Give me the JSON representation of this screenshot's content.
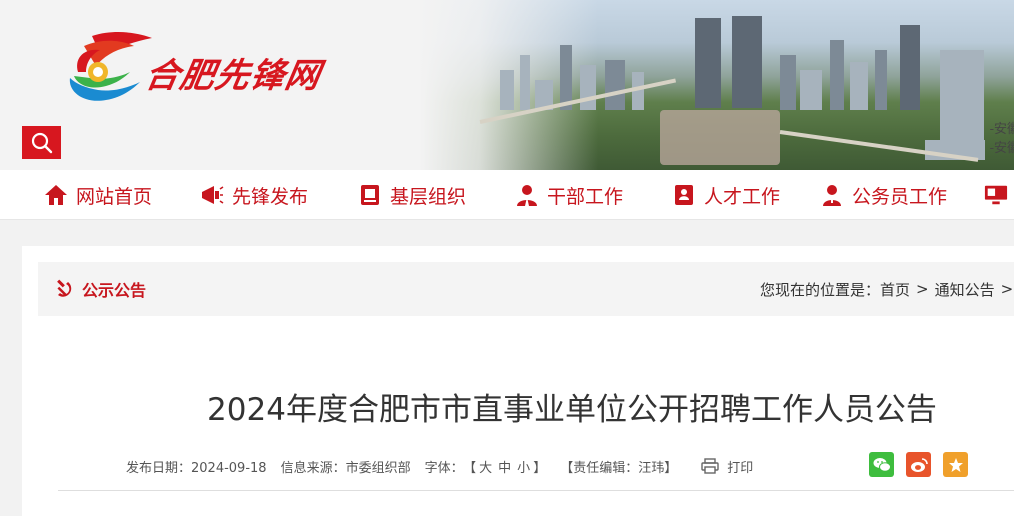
{
  "header": {
    "logo_text": "合肥先锋网",
    "banner_text": [
      "-安徽",
      "-安徽"
    ]
  },
  "search": {
    "icon": "search-icon"
  },
  "nav": {
    "items": [
      {
        "label": "网站首页",
        "icon": "home-icon"
      },
      {
        "label": "先锋发布",
        "icon": "megaphone-icon"
      },
      {
        "label": "基层组织",
        "icon": "party-book-icon"
      },
      {
        "label": "干部工作",
        "icon": "cadre-icon"
      },
      {
        "label": "人才工作",
        "icon": "talent-icon"
      },
      {
        "label": "公务员工作",
        "icon": "civil-servant-icon"
      },
      {
        "label": "",
        "icon": "monitor-icon"
      }
    ]
  },
  "section": {
    "title": "公示公告",
    "location_label": "您现在的位置是：",
    "crumbs": [
      "首页",
      "通知公告"
    ]
  },
  "article": {
    "title": "2024年度合肥市市直事业单位公开招聘工作人员公告",
    "publish_date_label": "发布日期：",
    "publish_date": "2024-09-18",
    "source_label": "信息来源：",
    "source": "市委组织部",
    "font_label": "字体：",
    "font_open": "【",
    "font_sizes": [
      "大",
      "中",
      "小"
    ],
    "font_close": "】",
    "editor": "【责任编辑：汪玮】",
    "print_label": "打印"
  },
  "share": [
    {
      "icon": "wechat-icon",
      "color": "#3ebd3e"
    },
    {
      "icon": "weibo-icon",
      "color": "#e8542b"
    },
    {
      "icon": "favorite-icon",
      "color": "#f0a02b"
    }
  ],
  "colors": {
    "accent": "#c7161e"
  }
}
